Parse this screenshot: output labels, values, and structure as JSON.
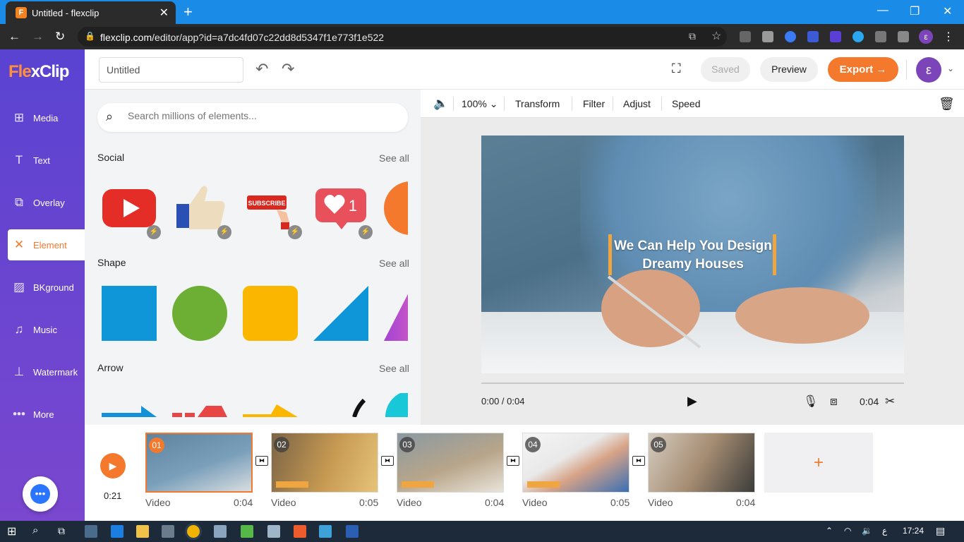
{
  "browser": {
    "tab_title": "Untitled - flexclip",
    "favicon_letter": "F",
    "url_host": "flexclip.com",
    "url_path": "/editor/app?id=a7dc4fd07c22dd8d5347f1e773f1e522",
    "profile_initial": "ε"
  },
  "brand": {
    "name_part1": "Fle",
    "name_part2": "xClip",
    "accent": "#f4792d",
    "sidebar_top": "#5a43d1"
  },
  "sidebar": {
    "items": [
      {
        "label": "Media",
        "icon": "media-add-icon"
      },
      {
        "label": "Text",
        "icon": "text-icon"
      },
      {
        "label": "Overlay",
        "icon": "overlay-icon"
      },
      {
        "label": "Element",
        "icon": "element-icon",
        "active": true
      },
      {
        "label": "BKground",
        "icon": "background-icon"
      },
      {
        "label": "Music",
        "icon": "music-icon"
      },
      {
        "label": "Watermark",
        "icon": "watermark-stamp-icon"
      },
      {
        "label": "More",
        "icon": "more-dots-icon"
      }
    ]
  },
  "topbar": {
    "project_title": "Untitled",
    "saved_label": "Saved",
    "preview_label": "Preview",
    "export_label": "Export",
    "user_initial": "ε"
  },
  "panel": {
    "search_placeholder": "Search millions of elements...",
    "see_all": "See all",
    "sections": [
      {
        "title": "Social"
      },
      {
        "title": "Shape"
      },
      {
        "title": "Arrow"
      }
    ],
    "subscribe_text": "SUBSCRIBE",
    "like_count": "1"
  },
  "editor": {
    "zoom": "100%",
    "tools": [
      "Transform",
      "Filter",
      "Adjust",
      "Speed"
    ],
    "overlay_line1": "We Can Help You Design",
    "overlay_line2": "Dreamy Houses",
    "time_current": "0:00 / 0:04",
    "clip_duration": "0:04"
  },
  "timeline": {
    "total": "0:21",
    "clips": [
      {
        "num": "01",
        "type": "Video",
        "duration": "0:04"
      },
      {
        "num": "02",
        "type": "Video",
        "duration": "0:05"
      },
      {
        "num": "03",
        "type": "Video",
        "duration": "0:04"
      },
      {
        "num": "04",
        "type": "Video",
        "duration": "0:05"
      },
      {
        "num": "05",
        "type": "Video",
        "duration": "0:04"
      }
    ]
  },
  "taskbar": {
    "time": "17:24",
    "lang": "ع"
  }
}
